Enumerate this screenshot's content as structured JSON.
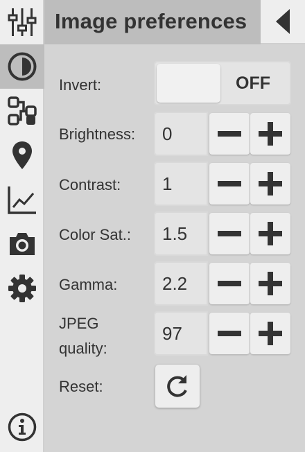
{
  "header": {
    "title": "Image preferences",
    "collapse_icon": "chevron-left-icon"
  },
  "sidebar": {
    "items": [
      {
        "icon": "sliders-icon",
        "active": false
      },
      {
        "icon": "contrast-icon",
        "active": true
      },
      {
        "icon": "route-icon",
        "active": false
      },
      {
        "icon": "map-pin-icon",
        "active": false
      },
      {
        "icon": "line-chart-icon",
        "active": false
      },
      {
        "icon": "camera-icon",
        "active": false
      },
      {
        "icon": "gear-icon",
        "active": false
      },
      {
        "icon": "info-icon",
        "active": false
      }
    ]
  },
  "prefs": {
    "invert": {
      "label": "Invert:",
      "value": "OFF"
    },
    "brightness": {
      "label": "Brightness:",
      "value": "0"
    },
    "contrast": {
      "label": "Contrast:",
      "value": "1"
    },
    "color_sat": {
      "label": "Color Sat.:",
      "value": "1.5"
    },
    "gamma": {
      "label": "Gamma:",
      "value": "2.2"
    },
    "jpeg_quality": {
      "label_line1": "JPEG",
      "label_line2": "quality:",
      "value": "97"
    },
    "reset": {
      "label": "Reset:"
    }
  },
  "colors": {
    "icon": "#333333",
    "sidebar_bg": "#eeeeee",
    "active_bg": "#bdbdbd",
    "panel_bg": "#d4d4d4"
  }
}
